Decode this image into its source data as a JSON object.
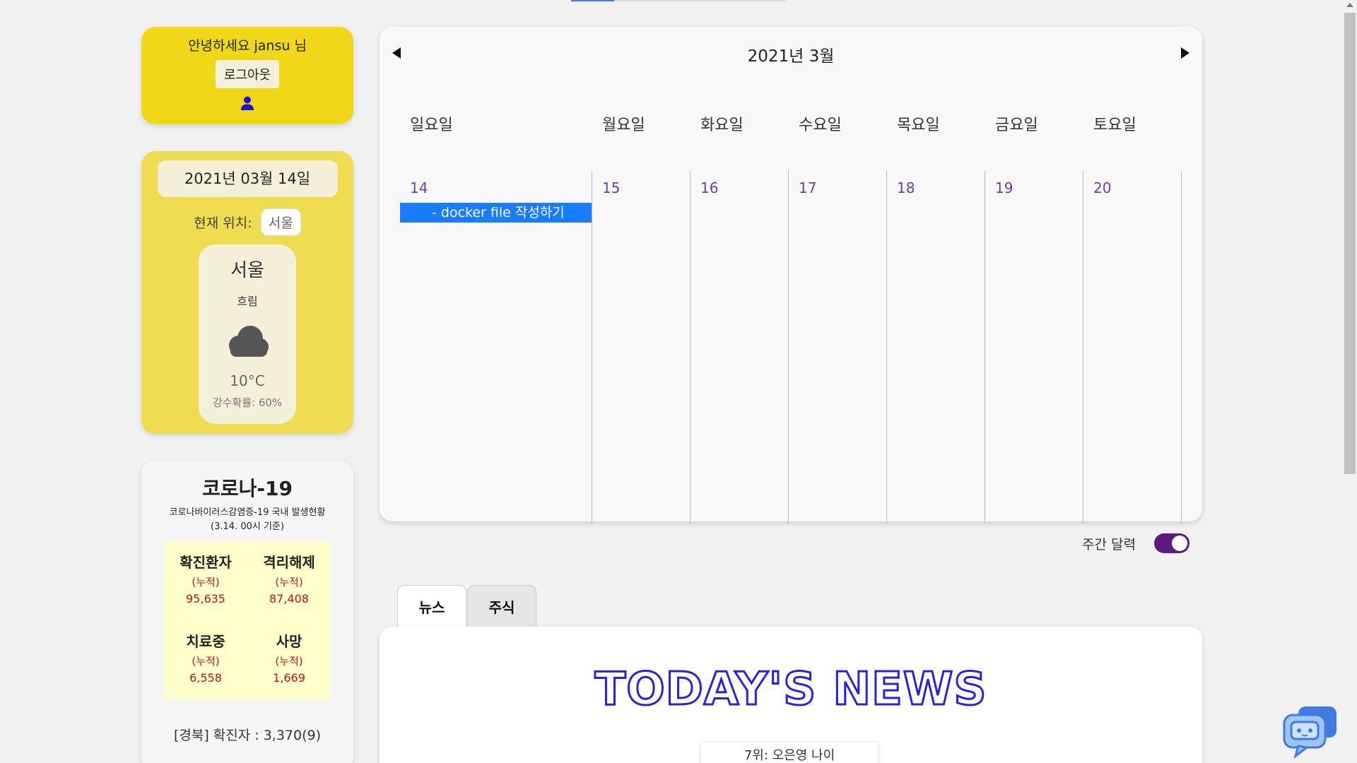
{
  "user": {
    "greeting": "안녕하세요 jansu 님",
    "logout_label": "로그아웃"
  },
  "weather": {
    "date": "2021년 03월 14일",
    "location_label": "현재 위치:",
    "location_value": "서울",
    "city": "서울",
    "condition": "흐림",
    "icon": "cloud-icon",
    "temperature": "10°C",
    "rain_chance": "강수확률: 60%"
  },
  "covid": {
    "title": "코로나-19",
    "subtitle": "코로나바이러스감염증-19 국내 발생현황",
    "as_of": "(3.14. 00시 기준)",
    "stats": [
      {
        "label": "확진환자",
        "sub": "(누적)",
        "value": "95,635"
      },
      {
        "label": "격리해제",
        "sub": "(누적)",
        "value": "87,408"
      },
      {
        "label": "치료중",
        "sub": "(누적)",
        "value": "6,558"
      },
      {
        "label": "사망",
        "sub": "(누적)",
        "value": "1,669"
      }
    ],
    "region_line": "[경북] 확진자 : 3,370(9)"
  },
  "calendar": {
    "title": "2021년 3월",
    "days": [
      {
        "name": "일요일",
        "date": "14",
        "event": "- docker file 작성하기"
      },
      {
        "name": "월요일",
        "date": "15"
      },
      {
        "name": "화요일",
        "date": "16"
      },
      {
        "name": "수요일",
        "date": "17"
      },
      {
        "name": "목요일",
        "date": "18"
      },
      {
        "name": "금요일",
        "date": "19"
      },
      {
        "name": "토요일",
        "date": "20"
      }
    ],
    "toggle_label": "주간 달력",
    "toggle_on": true
  },
  "tabs": [
    {
      "label": "뉴스",
      "active": true
    },
    {
      "label": "주식",
      "active": false
    }
  ],
  "news": {
    "logo_text": "TODAY'S NEWS",
    "item_text": "7위: 오은영 나이"
  },
  "colors": {
    "user_card": "#f0d818",
    "weather_card": "#f0dc50",
    "event": "#1a7cff",
    "toggle": "#5a1a80",
    "covid_number": "#c0141c",
    "news_logo_stroke": "#2a22d8"
  }
}
